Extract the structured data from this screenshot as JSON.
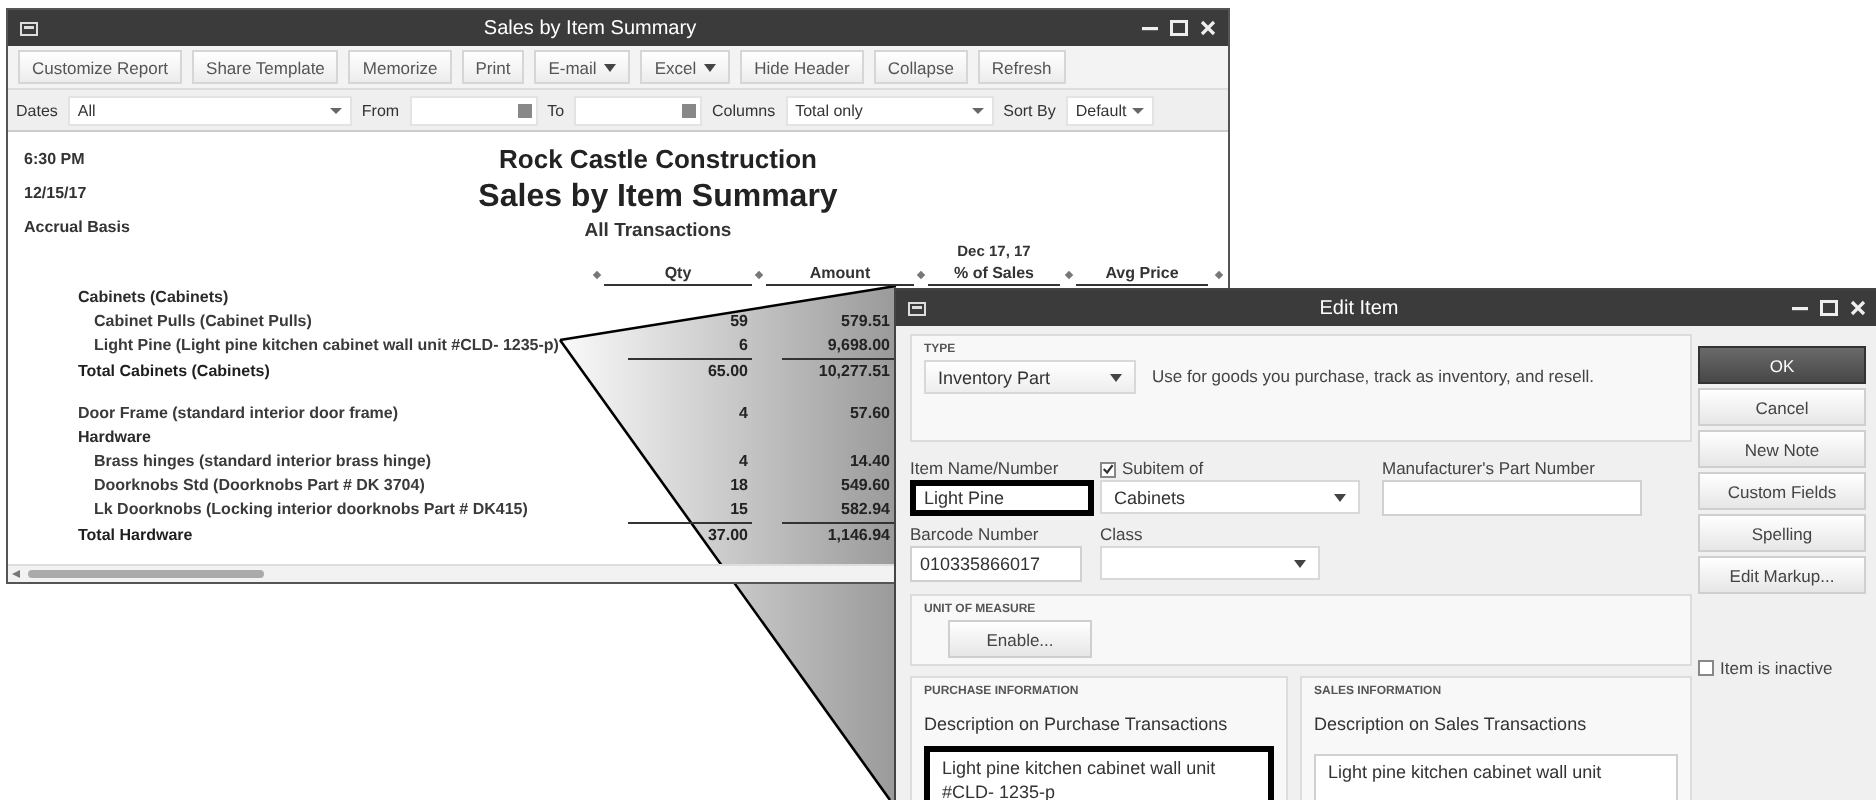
{
  "report_window": {
    "title": "Sales by Item Summary",
    "toolbar": [
      {
        "label": "Customize Report",
        "kind": "button"
      },
      {
        "label": "Share Template",
        "kind": "button"
      },
      {
        "label": "Memorize",
        "kind": "button"
      },
      {
        "label": "Print",
        "kind": "button"
      },
      {
        "label": "E-mail",
        "kind": "menu"
      },
      {
        "label": "Excel",
        "kind": "menu"
      },
      {
        "label": "Hide Header",
        "kind": "button"
      },
      {
        "label": "Collapse",
        "kind": "button"
      },
      {
        "label": "Refresh",
        "kind": "button"
      }
    ],
    "filters": [
      {
        "kind": "label",
        "text": "Dates"
      },
      {
        "kind": "select",
        "value": "All"
      },
      {
        "kind": "label",
        "text": "From"
      },
      {
        "kind": "date"
      },
      {
        "kind": "label",
        "text": "To"
      },
      {
        "kind": "date"
      },
      {
        "kind": "label",
        "text": "Columns"
      },
      {
        "kind": "select",
        "value": "Total only"
      },
      {
        "kind": "label",
        "text": "Sort By"
      },
      {
        "kind": "select",
        "value": "Default"
      }
    ],
    "report": {
      "time": "6:30 PM",
      "date": "12/15/17",
      "basis": "Accrual Basis",
      "company": "Rock Castle Construction",
      "title": "Sales by Item Summary",
      "subtitle": "All Transactions",
      "period": "Dec 17, 17",
      "columns": [
        "Qty",
        "Amount",
        "% of Sales",
        "Avg Price"
      ],
      "rows": [
        {
          "kind": "group",
          "label": "Cabinets (Cabinets)",
          "children": [
            {
              "kind": "item",
              "label": "Cabinet Pulls (Cabinet Pulls)",
              "qty": "59",
              "amount": "579.51"
            },
            {
              "kind": "item",
              "label": "Light Pine (Light pine kitchen cabinet wall unit  #CLD- 1235-p)",
              "qty": "6",
              "amount": "9,698.00"
            }
          ]
        },
        {
          "kind": "total",
          "label": "Total Cabinets (Cabinets)",
          "qty": "65.00",
          "amount": "10,277.51"
        },
        {
          "kind": "item",
          "label": "Door Frame (standard interior door frame)",
          "qty": "4",
          "amount": "57.60"
        },
        {
          "kind": "group",
          "label": "Hardware",
          "children": [
            {
              "kind": "item",
              "label": "Brass hinges (standard interior brass hinge)",
              "qty": "4",
              "amount": "14.40"
            },
            {
              "kind": "item",
              "label": "Doorknobs Std (Doorknobs Part # DK 3704)",
              "qty": "18",
              "amount": "549.60"
            },
            {
              "kind": "item",
              "label": "Lk Doorknobs (Locking interior doorknobs  Part # DK415)",
              "qty": "15",
              "amount": "582.94"
            }
          ]
        },
        {
          "kind": "total",
          "label": "Total Hardware",
          "qty": "37.00",
          "amount": "1,146.94"
        }
      ]
    }
  },
  "edit_item_window": {
    "title": "Edit Item",
    "type_section": {
      "heading": "TYPE",
      "type_value": "Inventory Part",
      "description": "Use for goods you purchase, track as inventory, and resell."
    },
    "item_name": {
      "label": "Item Name/Number",
      "value": "Light Pine",
      "highlighted": true
    },
    "subitem": {
      "label": "Subitem of",
      "checked": true,
      "value": "Cabinets"
    },
    "manufacturer_part": {
      "label": "Manufacturer's Part Number"
    },
    "barcode": {
      "label": "Barcode Number",
      "value": "010335866017"
    },
    "class_field": {
      "label": "Class"
    },
    "unit_of_measure": {
      "heading": "UNIT OF MEASURE",
      "button": "Enable..."
    },
    "purchase": {
      "heading": "PURCHASE INFORMATION",
      "label": "Description on Purchase Transactions",
      "value": "Light pine kitchen cabinet wall unit\n#CLD- 1235-p",
      "highlighted": true
    },
    "sales": {
      "heading": "SALES INFORMATION",
      "label": "Description on Sales Transactions",
      "value": "Light pine kitchen cabinet wall unit",
      "highlighted": false
    },
    "buttons": [
      {
        "label": "OK",
        "primary": true
      },
      {
        "label": "Cancel",
        "primary": false
      },
      {
        "label": "New Note",
        "primary": false
      },
      {
        "label": "Custom Fields",
        "primary": false
      },
      {
        "label": "Spelling",
        "primary": false
      },
      {
        "label": "Edit Markup...",
        "primary": false
      }
    ],
    "inactive": {
      "label": "Item is inactive",
      "checked": false
    }
  }
}
